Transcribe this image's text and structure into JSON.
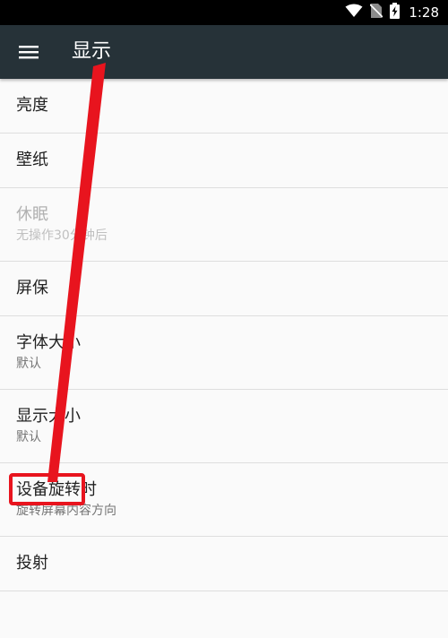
{
  "status_bar": {
    "time": "1:28",
    "icons": [
      "wifi-icon",
      "no-sim-icon",
      "battery-charging-icon"
    ]
  },
  "app_bar": {
    "title": "显示",
    "menu_icon": "hamburger-menu-icon"
  },
  "settings": [
    {
      "title": "亮度",
      "summary": null,
      "enabled": true
    },
    {
      "title": "壁纸",
      "summary": null,
      "enabled": true
    },
    {
      "title": "休眠",
      "summary": "无操作30分钟后",
      "enabled": false
    },
    {
      "title": "屏保",
      "summary": null,
      "enabled": true
    },
    {
      "title": "字体大小",
      "summary": "默认",
      "enabled": true
    },
    {
      "title": "显示大小",
      "summary": "默认",
      "enabled": true
    },
    {
      "title": "设备旋转时",
      "summary": "旋转屏幕内容方向",
      "enabled": true
    },
    {
      "title": "投射",
      "summary": null,
      "enabled": true
    }
  ],
  "colors": {
    "status_bar": "#000000",
    "app_bar": "#263238",
    "background": "#fafafa",
    "annotation": "#e8141e"
  }
}
